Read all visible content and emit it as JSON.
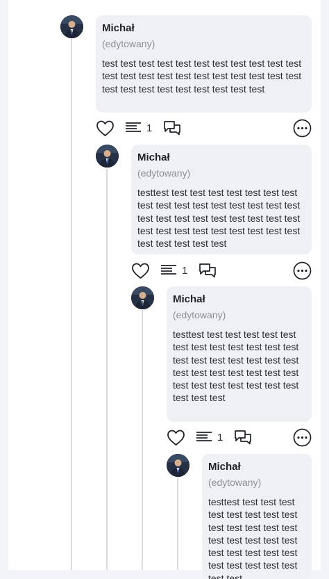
{
  "comments": [
    {
      "author": "Michał",
      "edited_label": "(edytowany)",
      "text": "test test test test test test test test test test test test test test test test test test test test test test test test test test test test test test test",
      "replies_count": "1"
    },
    {
      "author": "Michał",
      "edited_label": "(edytowany)",
      "text": "testtest test test test test test test test test test test test test test test test test test test test test test test test test test test test test test test test test test test test test test test test",
      "replies_count": "1"
    },
    {
      "author": "Michał",
      "edited_label": "(edytowany)",
      "text": "testtest test test test test test test test test test test test test test test test test test test test test test test test test test test test test test test test test test test test test",
      "replies_count": "1"
    },
    {
      "author": "Michał",
      "edited_label": "(edytowany)",
      "text": "testtest test test test test test test test test test test test test test test test test test test test test test test test test test test test test test test"
    }
  ],
  "icons": {
    "like": "heart-icon",
    "replies": "lines-icon",
    "reply": "chat-bubbles-icon",
    "more": "more-dots-icon"
  },
  "colors": {
    "bubble": "#eff0f4",
    "thread_line": "#d9dbe0",
    "icon": "#1f2329"
  }
}
